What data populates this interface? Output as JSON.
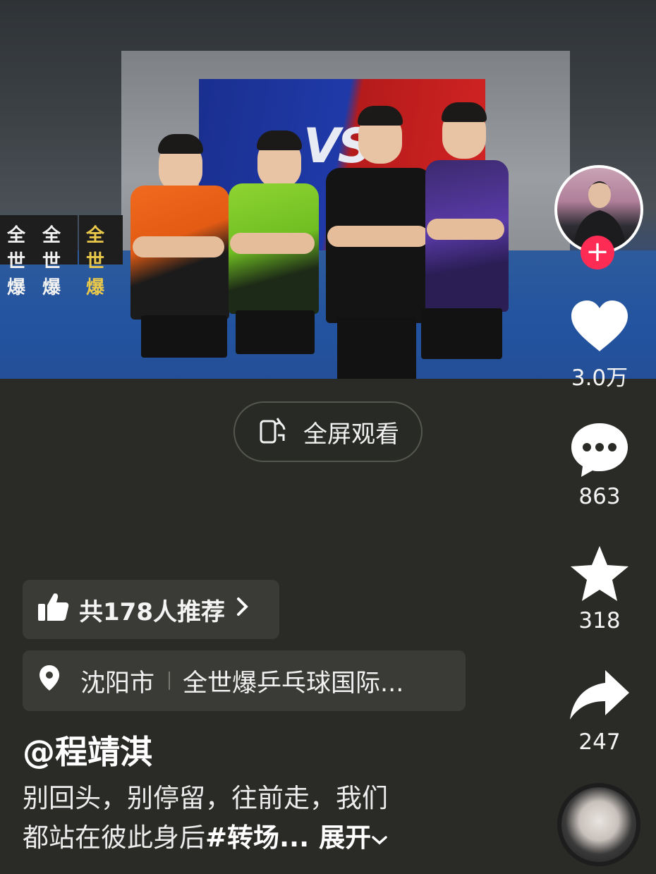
{
  "video": {
    "wall_banners": [
      "全世爆",
      "全世爆",
      "全世爆"
    ],
    "screen_text": "VS"
  },
  "fullscreen": {
    "label": "全屏观看"
  },
  "rail": {
    "likes": "3.0万",
    "comments": "863",
    "favorites": "318",
    "shares": "247",
    "follow_symbol": "+"
  },
  "recommend": {
    "label": "共178人推荐"
  },
  "location": {
    "city": "沈阳市",
    "place": "全世爆乒乓球国际..."
  },
  "post": {
    "author": "@程靖淇",
    "desc_line1": "别回头，别停留，往前走，我们",
    "desc_line2_text": "都站在彼此身后",
    "desc_hashtag": "#转场...",
    "expand_label": "展开"
  },
  "colors": {
    "accent": "#fe2c55",
    "background": "#2a2b27"
  }
}
